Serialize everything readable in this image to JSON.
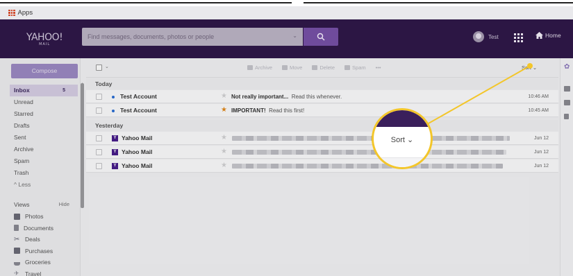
{
  "browser": {
    "bookmark_apps": "Apps"
  },
  "header": {
    "logo": "YAHOO!",
    "logo_sub": "MAIL",
    "search_placeholder": "Find messages, documents, photos or people",
    "user_name": "Test",
    "home_label": "Home"
  },
  "sidebar": {
    "compose_label": "Compose",
    "items": [
      {
        "label": "Inbox",
        "count": "5",
        "active": true
      },
      {
        "label": "Unread"
      },
      {
        "label": "Starred"
      },
      {
        "label": "Drafts"
      },
      {
        "label": "Sent"
      },
      {
        "label": "Archive"
      },
      {
        "label": "Spam"
      },
      {
        "label": "Trash"
      },
      {
        "label": "^ Less"
      }
    ],
    "views_label": "Views",
    "views_hide": "Hide",
    "views": [
      {
        "label": "Photos",
        "color": "#6b6b78"
      },
      {
        "label": "Documents",
        "color": "#8a8a94"
      },
      {
        "label": "Deals",
        "color": "#6b6b78"
      },
      {
        "label": "Purchases",
        "color": "#6b6b78"
      },
      {
        "label": "Groceries",
        "color": "#8a8a94"
      },
      {
        "label": "Travel",
        "color": "#8a8a94"
      }
    ]
  },
  "toolbar": {
    "archive": "Archive",
    "move": "Move",
    "delete": "Delete",
    "spam": "Spam",
    "more": "•••",
    "sort": "Sort ⌄"
  },
  "messages": {
    "today_label": "Today",
    "yesterday_label": "Yesterday",
    "today": [
      {
        "sender": "Test Account",
        "subject_bold": "Not really important...",
        "preview": "Read this whenever.",
        "time": "10:46 AM",
        "starred": false
      },
      {
        "sender": "Test Account",
        "subject_bold": "IMPORTANT!",
        "preview": "Read this first!",
        "time": "10:45 AM",
        "starred": true
      }
    ],
    "yesterday": [
      {
        "sender": "Yahoo Mail",
        "time": "Jun 12",
        "blur_width": 400
      },
      {
        "sender": "Yahoo Mail",
        "time": "Jun 12",
        "blur_width": 395
      },
      {
        "sender": "Yahoo Mail",
        "time": "Jun 12",
        "blur_width": 390
      }
    ]
  },
  "callout": {
    "sort_label": "Sort ⌄",
    "accent_color": "#f3c62a"
  }
}
